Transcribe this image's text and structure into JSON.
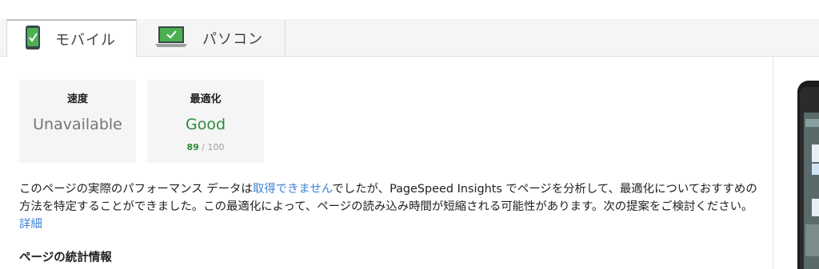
{
  "tabs": [
    {
      "label": "モバイル",
      "icon": "mobile-phone-check-icon",
      "active": true
    },
    {
      "label": "パソコン",
      "icon": "laptop-check-icon",
      "active": false
    }
  ],
  "cards": {
    "speed": {
      "title": "速度",
      "value": "Unavailable"
    },
    "optimization": {
      "title": "最適化",
      "value": "Good",
      "score": "89",
      "score_suffix": " / 100"
    }
  },
  "description": {
    "part1": "このページの実際のパフォーマンス データは",
    "link1": "取得できません",
    "part2": "でしたが、PageSpeed Insights でページを分析して、最適化についておすすめの方法を特定することができました。この最適化によって、ページの読み込み時間が短縮される可能性があります。次の提案をご検討ください。",
    "link2": "詳細"
  },
  "section_title": "ページの統計情報",
  "colors": {
    "good": "#2e8b3a",
    "link": "#3b82d6",
    "android_green": "#4caf50"
  }
}
